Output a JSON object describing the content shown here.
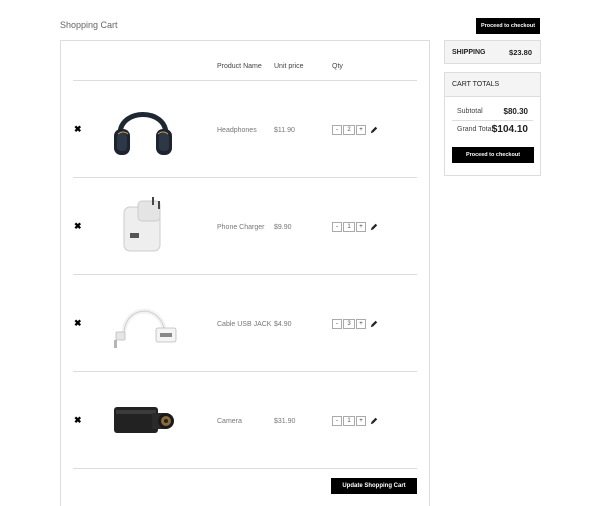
{
  "page": {
    "title": "Shopping Cart",
    "proceed_label": "Proceed to checkout"
  },
  "cart": {
    "headers": {
      "product_name": "Product Name",
      "unit_price": "Unit price",
      "qty": "Qty"
    },
    "items": [
      {
        "name": "Headphones",
        "price": "$11.90",
        "qty": "2",
        "icon": "headphones-image"
      },
      {
        "name": "Phone Charger",
        "price": "$9.90",
        "qty": "1",
        "icon": "phone-charger-image"
      },
      {
        "name": "Cable USB JACK",
        "price": "$4.90",
        "qty": "3",
        "icon": "usb-cable-image"
      },
      {
        "name": "Camera",
        "price": "$31.90",
        "qty": "1",
        "icon": "camera-image"
      }
    ],
    "stepper": {
      "minus": "-",
      "plus": "+"
    },
    "update_label": "Update Shopping Cart"
  },
  "shipping": {
    "label": "SHIPPING",
    "value": "$23.80"
  },
  "totals": {
    "heading": "CART TOTALS",
    "subtotal_label": "Subtotal",
    "subtotal_value": "$80.30",
    "grand_total_label": "Grand Total",
    "grand_total_value": "$104.10",
    "proceed_label": "Proceed to checkout"
  }
}
